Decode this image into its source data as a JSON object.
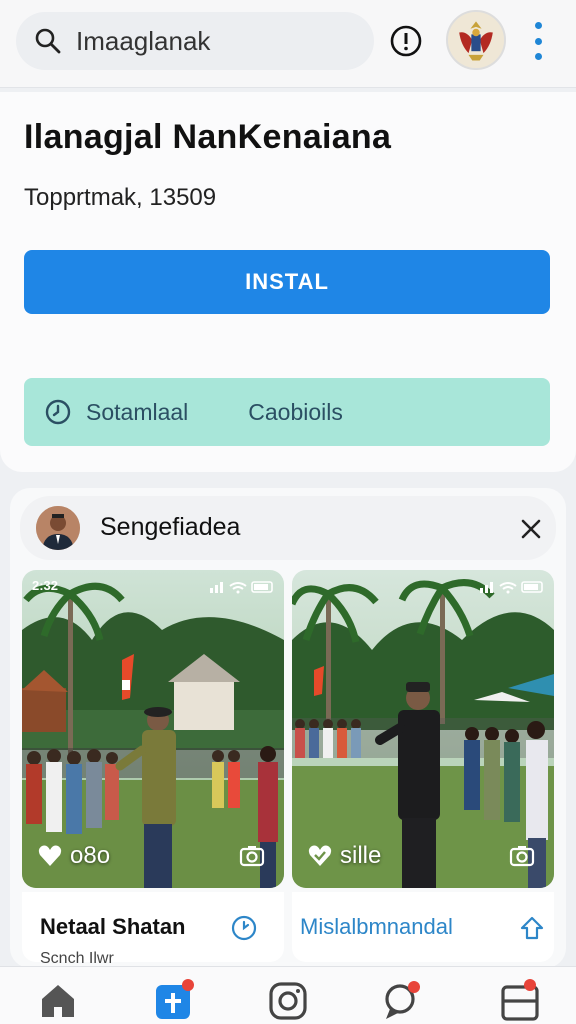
{
  "search": {
    "value": "Imaaglanak"
  },
  "app": {
    "title": "Ilanagjal NanKenaiana",
    "subtitle": "Topprtmak, 13509",
    "install_label": "INSTAL",
    "chip_left": "Sotamlaal",
    "chip_right": "Caobioils"
  },
  "feed": {
    "user_name": "Sengefiadea",
    "tiles": [
      {
        "overlay_label": "o8o",
        "status_left": "2:32",
        "caption_title": "Netaal Shatan",
        "caption_sub": "Scnch Ilwr"
      },
      {
        "overlay_label": "sille",
        "caption_title": "Mislalbmnandal"
      }
    ]
  },
  "icons": [
    "search-icon",
    "info-icon",
    "kebab-menu-icon",
    "clock-icon",
    "close-icon",
    "heart-icon",
    "camera-icon",
    "share-icon",
    "home-icon",
    "add-post-icon",
    "instagram-icon",
    "chat-icon",
    "layers-icon"
  ],
  "colors": {
    "accent": "#1f86e6",
    "chip_bg": "#a8e6d9",
    "badge": "#e8443a",
    "link": "#2d86c8"
  }
}
